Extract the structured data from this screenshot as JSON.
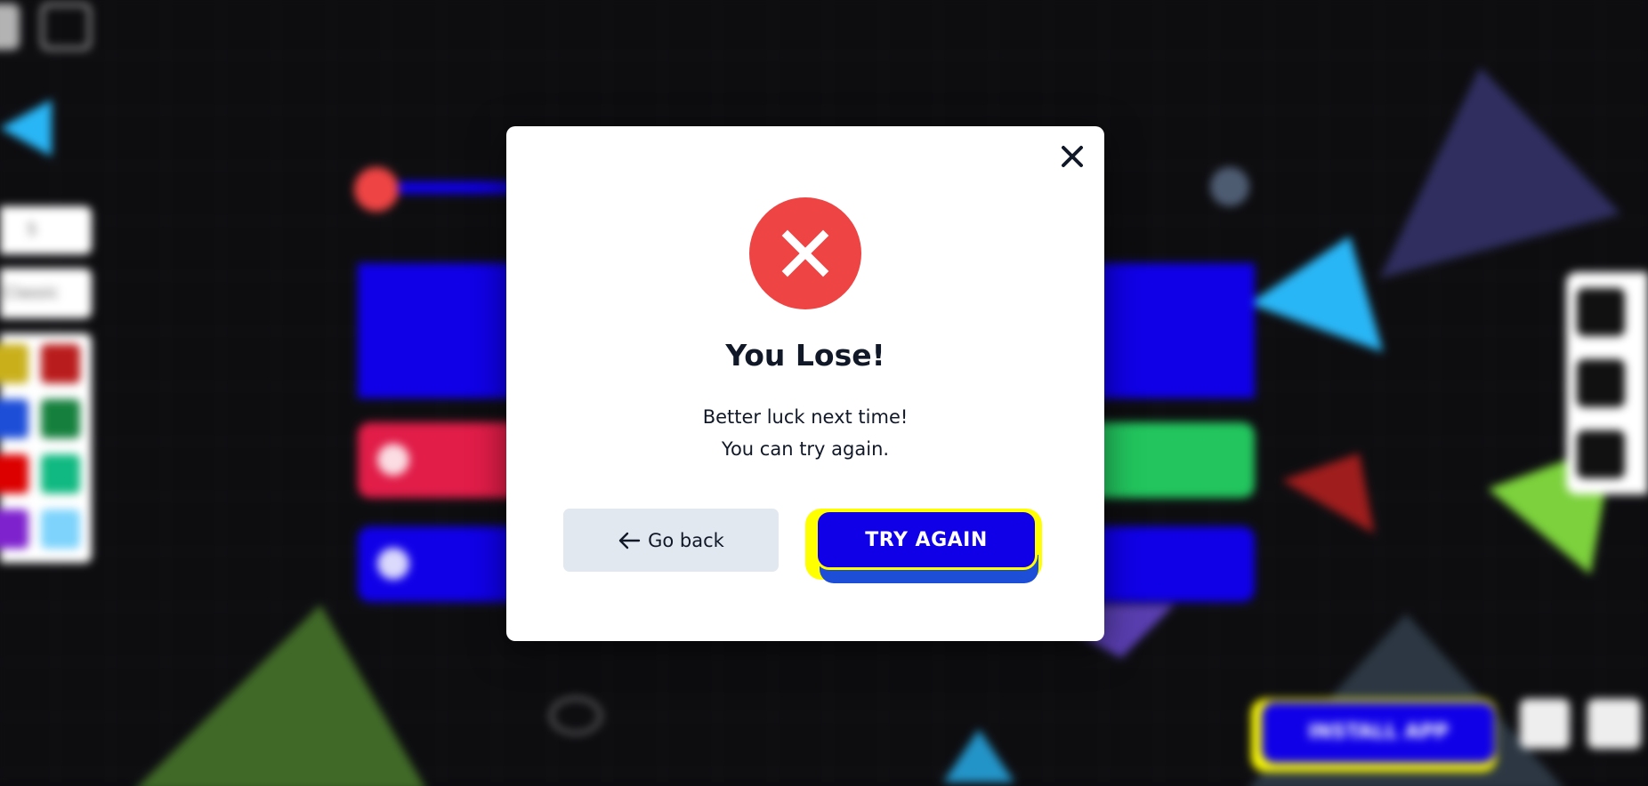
{
  "background": {
    "left_panel": {
      "input_value": "5",
      "select_value": "Classic",
      "swatch_colors": [
        "#c9b01b",
        "#b91c1c",
        "#1d4ed8",
        "#15803d",
        "#dc0000",
        "#10b981",
        "#7e22ce",
        "#7dd3fc"
      ]
    },
    "game_bars": {
      "top_color": "#1000e8",
      "red_color": "#e11d48",
      "green_color": "#22c55e",
      "blue_color": "#1000e8",
      "red_bar_label": "0",
      "blue_bar_label": "0"
    },
    "install_app_label": "INSTALL APP"
  },
  "modal": {
    "close_icon": "close-icon",
    "status_icon": "x-circle-icon",
    "status_color": "#ef4444",
    "title": "You Lose!",
    "message_line1": "Better luck next time!",
    "message_line2": "You can try again.",
    "go_back_label": "Go back",
    "go_back_icon": "arrow-left-icon",
    "try_again_label": "TRY AGAIN",
    "try_again_color": "#1000e8",
    "try_again_border": "#ffff00"
  }
}
